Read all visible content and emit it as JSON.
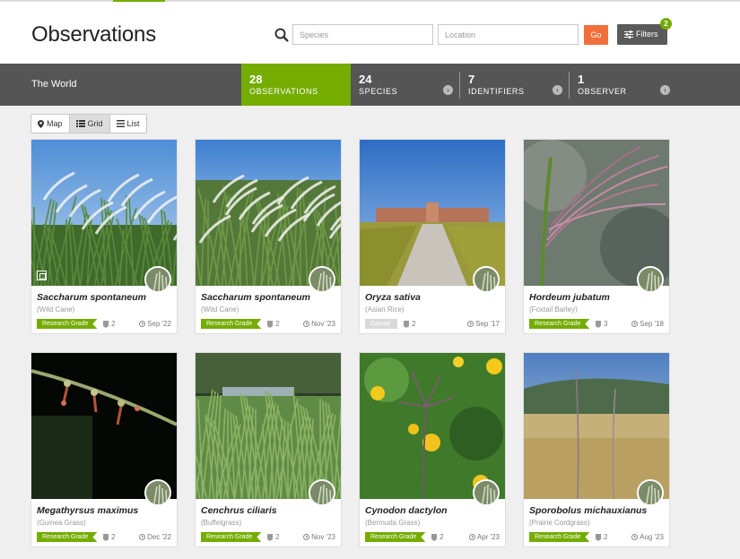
{
  "header": {
    "title": "Observations",
    "species_placeholder": "Species",
    "location_placeholder": "Location",
    "go_label": "Go",
    "filters_label": "Filters",
    "filters_count": "2"
  },
  "stats": {
    "place": "The World",
    "items": [
      {
        "num": "28",
        "label": "OBSERVATIONS"
      },
      {
        "num": "24",
        "label": "SPECIES"
      },
      {
        "num": "7",
        "label": "IDENTIFIERS"
      },
      {
        "num": "1",
        "label": "OBSERVER"
      }
    ]
  },
  "views": {
    "map": "Map",
    "grid": "Grid",
    "list": "List"
  },
  "cards": [
    {
      "sci": "Saccharum spontaneum",
      "common": "(Wild Cane)",
      "grade": "Research Grade",
      "ids": "2",
      "date": "Sep '22"
    },
    {
      "sci": "Saccharum spontaneum",
      "common": "(Wild Cane)",
      "grade": "Research Grade",
      "ids": "2",
      "date": "Nov '23"
    },
    {
      "sci": "Oryza sativa",
      "common": "(Asian Rice)",
      "grade": "Casual",
      "ids": "2",
      "date": "Sep '17"
    },
    {
      "sci": "Hordeum jubatum",
      "common": "(Foxtail Barley)",
      "grade": "Research Grade",
      "ids": "3",
      "date": "Sep '18"
    },
    {
      "sci": "Megathyrsus maximus",
      "common": "(Guinea Grass)",
      "grade": "Research Grade",
      "ids": "2",
      "date": "Dec '22"
    },
    {
      "sci": "Cenchrus ciliaris",
      "common": "(Buffelgrass)",
      "grade": "Research Grade",
      "ids": "2",
      "date": "Nov '23"
    },
    {
      "sci": "Cynodon dactylon",
      "common": "(Bermuda Grass)",
      "grade": "Research Grade",
      "ids": "2",
      "date": "Apr '23"
    },
    {
      "sci": "Sporobolus michauxianus",
      "common": "(Prairie Cordgrass)",
      "grade": "Research Grade",
      "ids": "2",
      "date": "Aug '23"
    }
  ]
}
